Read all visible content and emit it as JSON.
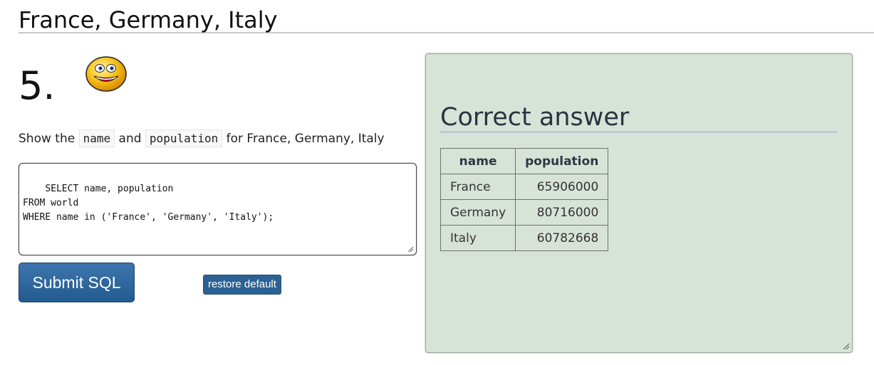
{
  "section": {
    "title": "France, Germany, Italy"
  },
  "question": {
    "number": "5.",
    "smiley_icon": "grinning-smiley-icon",
    "instruction_prefix": "Show the",
    "code_1": "name",
    "instruction_and": "and",
    "code_2": "population",
    "instruction_suffix": "for France, Germany, Italy"
  },
  "editor": {
    "sql": "SELECT name, population\nFROM world\nWHERE name in ('France', 'Germany', 'Italy');"
  },
  "buttons": {
    "submit_label": "Submit SQL",
    "restore_label": "restore default"
  },
  "answer": {
    "title": "Correct answer",
    "columns": [
      "name",
      "population"
    ],
    "rows": [
      {
        "name": "France",
        "population": "65906000"
      },
      {
        "name": "Germany",
        "population": "80716000"
      },
      {
        "name": "Italy",
        "population": "60782668"
      }
    ]
  },
  "colors": {
    "panel_bg": "#d8e3d8",
    "button_blue": "#2c6194"
  }
}
